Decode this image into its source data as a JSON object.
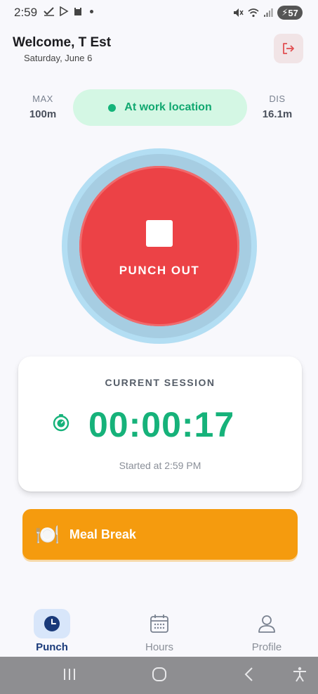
{
  "status_bar": {
    "time": "2:59",
    "battery": "57"
  },
  "header": {
    "title": "Welcome, T Est",
    "date": "Saturday, June 6"
  },
  "location": {
    "max_label": "MAX",
    "max_value": "100m",
    "status": "At work location",
    "dis_label": "DIS",
    "dis_value": "16.1m"
  },
  "punch": {
    "label": "PUNCH OUT"
  },
  "session": {
    "title": "CURRENT SESSION",
    "timer": "00:00:17",
    "started": "Started at 2:59 PM"
  },
  "meal": {
    "label": "Meal Break"
  },
  "nav": {
    "items": [
      {
        "label": "Punch",
        "icon": "clock-icon"
      },
      {
        "label": "Hours",
        "icon": "calendar-icon"
      },
      {
        "label": "Profile",
        "icon": "person-icon"
      }
    ]
  },
  "colors": {
    "accent_green": "#16b27a",
    "punch_red": "#ec4246",
    "meal_orange": "#f59b0e",
    "nav_active": "#1a3a7a"
  }
}
